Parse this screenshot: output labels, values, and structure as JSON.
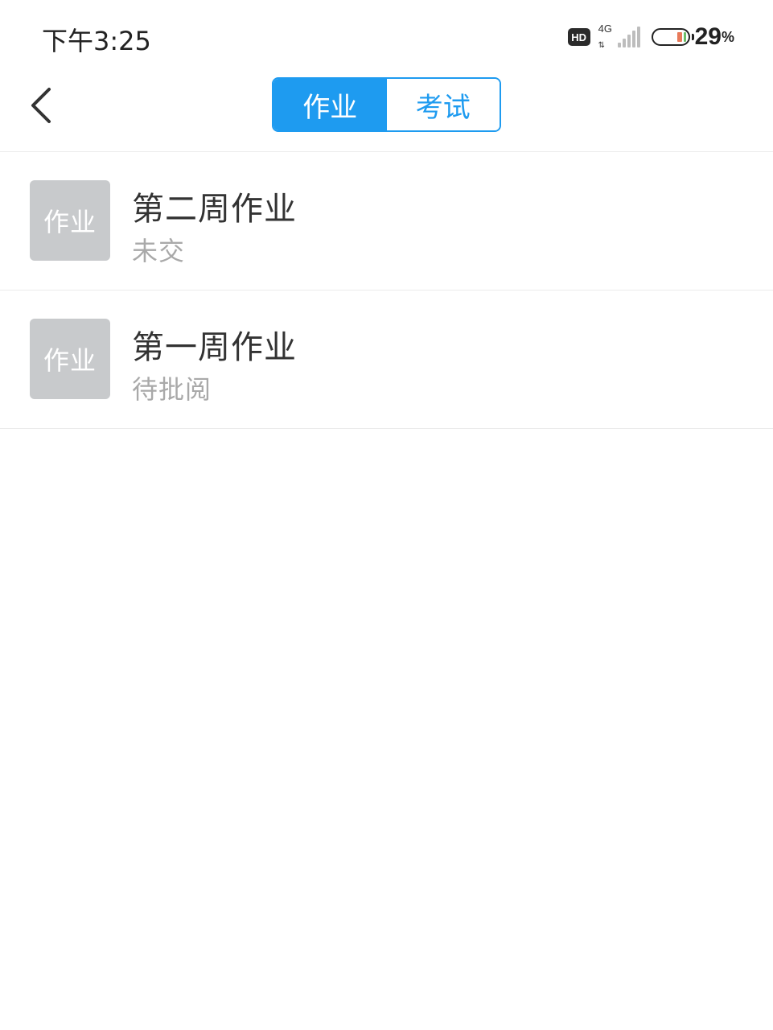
{
  "status_bar": {
    "time": "下午3:25",
    "hd_label": "HD",
    "network_label": "4G",
    "battery_value": "29",
    "battery_unit": "%",
    "battery_level": 0.29
  },
  "nav": {
    "back_icon": "chevron-left-icon",
    "tabs": [
      {
        "label": "作业",
        "active": true
      },
      {
        "label": "考试",
        "active": false
      }
    ]
  },
  "assignments": [
    {
      "thumb_label": "作业",
      "title": "第二周作业",
      "status": "未交"
    },
    {
      "thumb_label": "作业",
      "title": "第一周作业",
      "status": "待批阅"
    }
  ],
  "colors": {
    "accent": "#1e9bf0",
    "thumb_bg": "#c8cacc",
    "status_text": "#a9a9a9"
  }
}
